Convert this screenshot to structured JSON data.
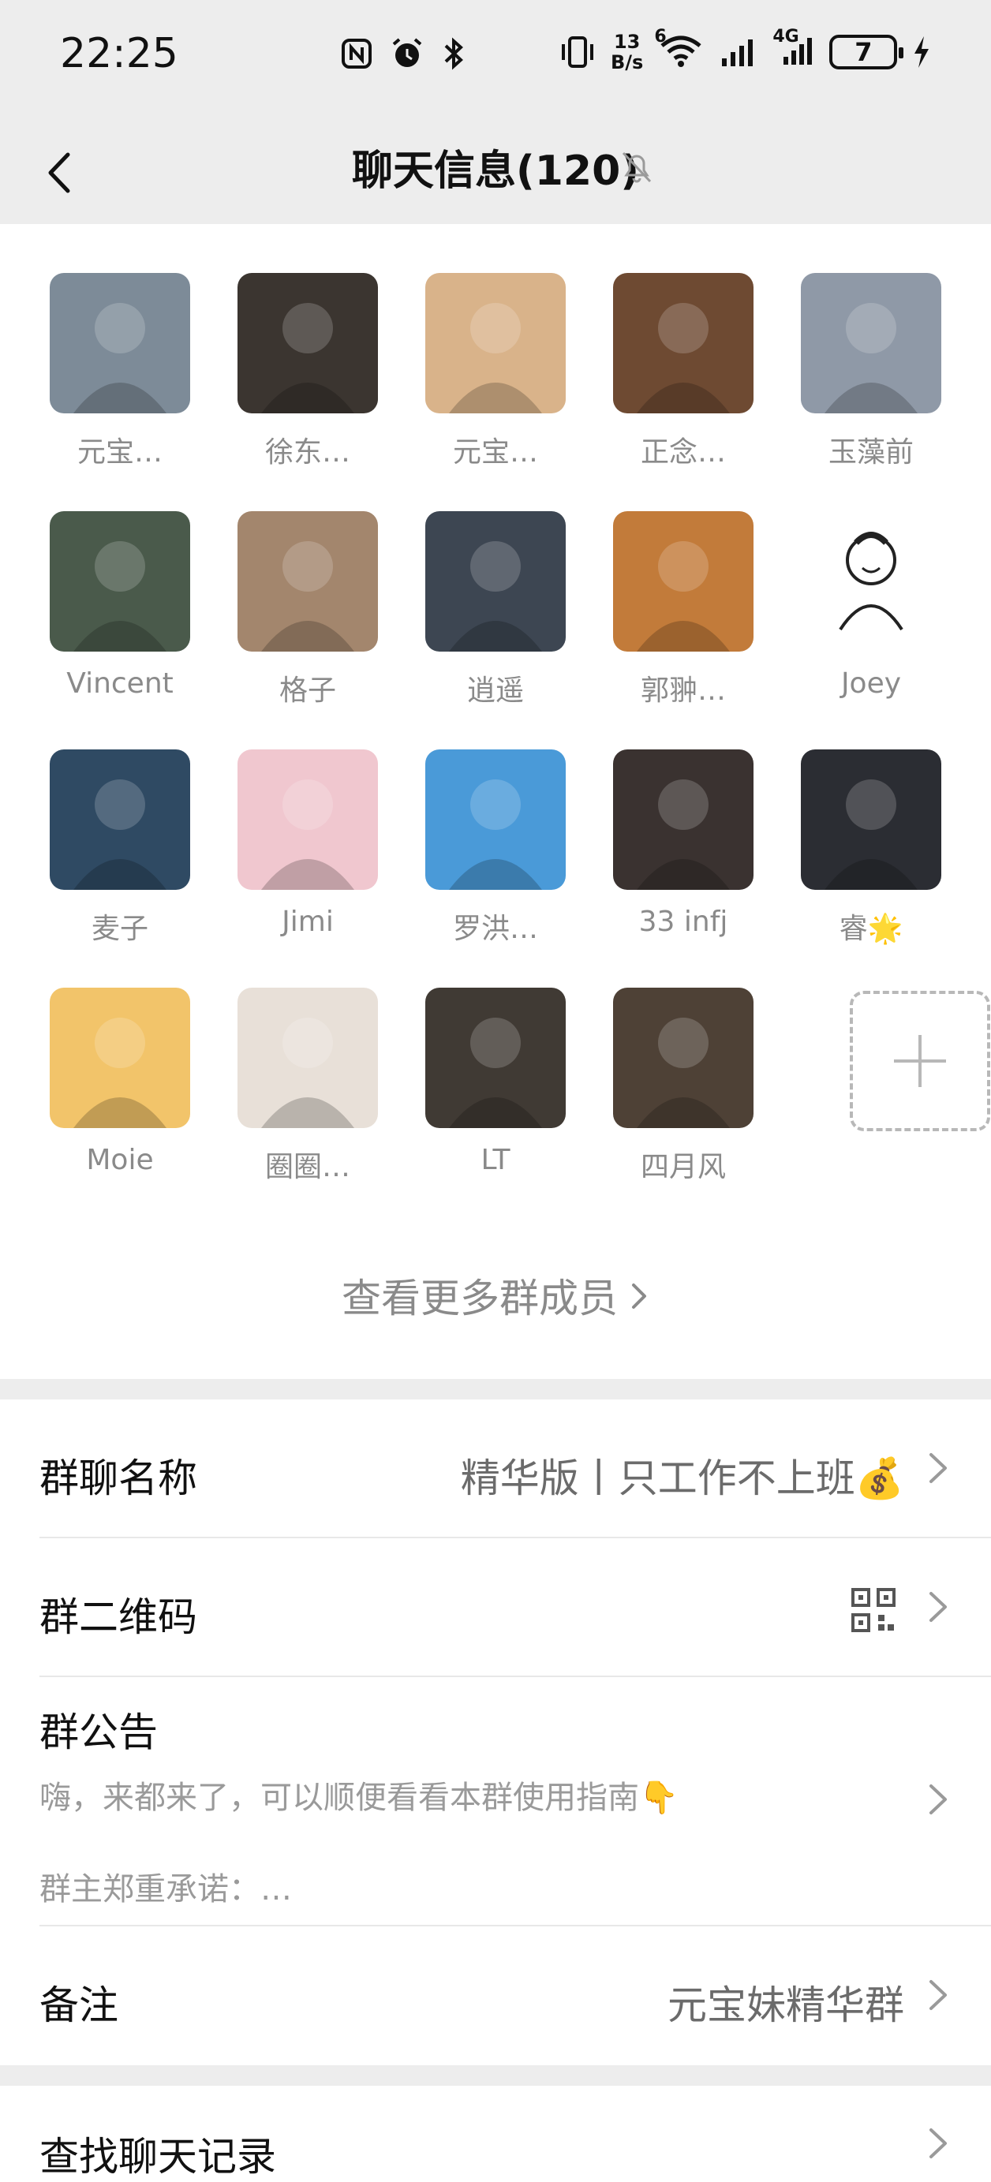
{
  "status_bar": {
    "time": "22:25",
    "net_speed_top": "13",
    "net_speed_bottom": "B/s",
    "wifi_label": "6",
    "cell_label": "4G",
    "battery": "7"
  },
  "nav": {
    "title": "聊天信息(120)",
    "back_icon": "chevron-left-icon",
    "mute_icon": "bell-muted-icon"
  },
  "members": [
    {
      "name": "元宝…",
      "color": "#7d8b98"
    },
    {
      "name": "徐东…",
      "color": "#3b3530"
    },
    {
      "name": "元宝…",
      "color": "#d9b38a"
    },
    {
      "name": "正念…",
      "color": "#6e4a32"
    },
    {
      "name": "玉藻前",
      "color": "#8f99a7"
    },
    {
      "name": "Vincent",
      "color": "#4a5a4b"
    },
    {
      "name": "格子",
      "color": "#a3866d"
    },
    {
      "name": "逍遥",
      "color": "#3d4652"
    },
    {
      "name": "郭翀…",
      "color": "#c27b3a"
    },
    {
      "name": "Joey",
      "color": "#ffffff"
    },
    {
      "name": "麦子",
      "color": "#2f4a63"
    },
    {
      "name": "Jimi",
      "color": "#f0c7cf"
    },
    {
      "name": "罗洪…",
      "color": "#4a9ad8"
    },
    {
      "name": "33 infj",
      "color": "#3a3230"
    },
    {
      "name": "睿🌟",
      "color": "#2b2d33"
    },
    {
      "name": "Moie",
      "color": "#f2c46a"
    },
    {
      "name": "圈圈…",
      "color": "#e8e0d8"
    },
    {
      "name": "LT",
      "color": "#403a34"
    },
    {
      "name": "四月风",
      "color": "#4e4136"
    }
  ],
  "add_member_icon": "plus-icon",
  "more_members_label": "查看更多群成员",
  "settings": {
    "group_name_label": "群聊名称",
    "group_name_value": "精华版丨只工作不上班💰",
    "qr_label": "群二维码",
    "qr_icon": "qr-code-icon",
    "notice_label": "群公告",
    "notice_line1": "嗨，来都来了，可以顺便看看本群使用指南👇",
    "notice_line2": "群主郑重承诺：…",
    "remark_label": "备注",
    "remark_value": "元宝妹精华群",
    "search_label": "查找聊天记录"
  },
  "colors": {
    "background": "#ededed",
    "text_primary": "#111111",
    "text_secondary": "#8a8a8a"
  }
}
